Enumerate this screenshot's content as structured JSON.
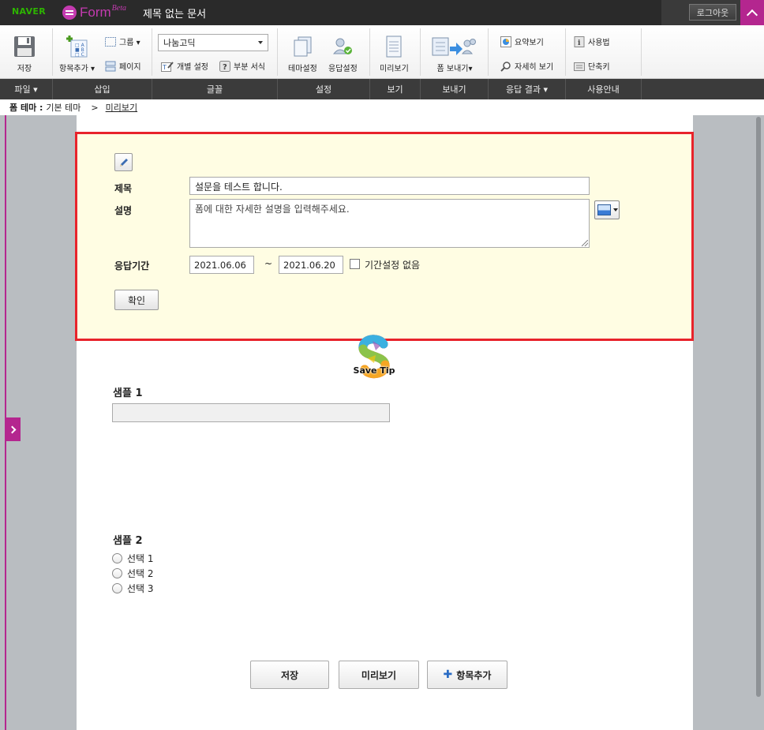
{
  "topbar": {
    "brand": "NAVER",
    "app_name": "Form",
    "app_badge": "Beta",
    "doc_title": "제목 없는 문서",
    "logout_label": "로그아웃"
  },
  "ribbon": {
    "save": "저장",
    "add_item": "항목추가",
    "group": "그룹",
    "page": "페이지",
    "font_value": "나눔고딕",
    "individual_setting": "개별 설정",
    "partial_format": "부분 서식",
    "theme_setting": "테마설정",
    "response_setting": "응답설정",
    "preview": "미리보기",
    "send_form": "폼 보내기",
    "summary_view": "요약보기",
    "detail_view": "자세히 보기",
    "howto": "사용법",
    "shortcut": "단축키",
    "groups": {
      "file": "파일",
      "insert": "삽입",
      "font": "글꼴",
      "settings": "설정",
      "view": "보기",
      "send": "보내기",
      "results": "응답 결과",
      "guide": "사용안내"
    }
  },
  "breadcrumb": {
    "label": "폼 테마 :",
    "theme": "기본 테마",
    "sep": ">",
    "current": "미리보기"
  },
  "form_header": {
    "title_label": "제목",
    "title_value": "설문을 테스트 합니다.",
    "desc_label": "설명",
    "desc_placeholder": "폼에 대한 자세한 설명을 입력해주세요.",
    "period_label": "응답기간",
    "start_date": "2021.06.06",
    "tilde": "~",
    "end_date": "2021.06.20",
    "no_period_label": "기간설정 없음",
    "confirm": "확인"
  },
  "watermark": "Save Tip",
  "questions": [
    {
      "title": "샘플 1"
    },
    {
      "title": "샘플 2",
      "options": [
        "선택 1",
        "선택 2",
        "선택 3"
      ]
    }
  ],
  "bottom": {
    "save": "저장",
    "preview": "미리보기",
    "add_item": "항목추가"
  },
  "colors": {
    "accent": "#b4268f",
    "highlight_border": "#e8232b",
    "edit_bg": "#fffde3",
    "naver_green": "#2db400"
  }
}
